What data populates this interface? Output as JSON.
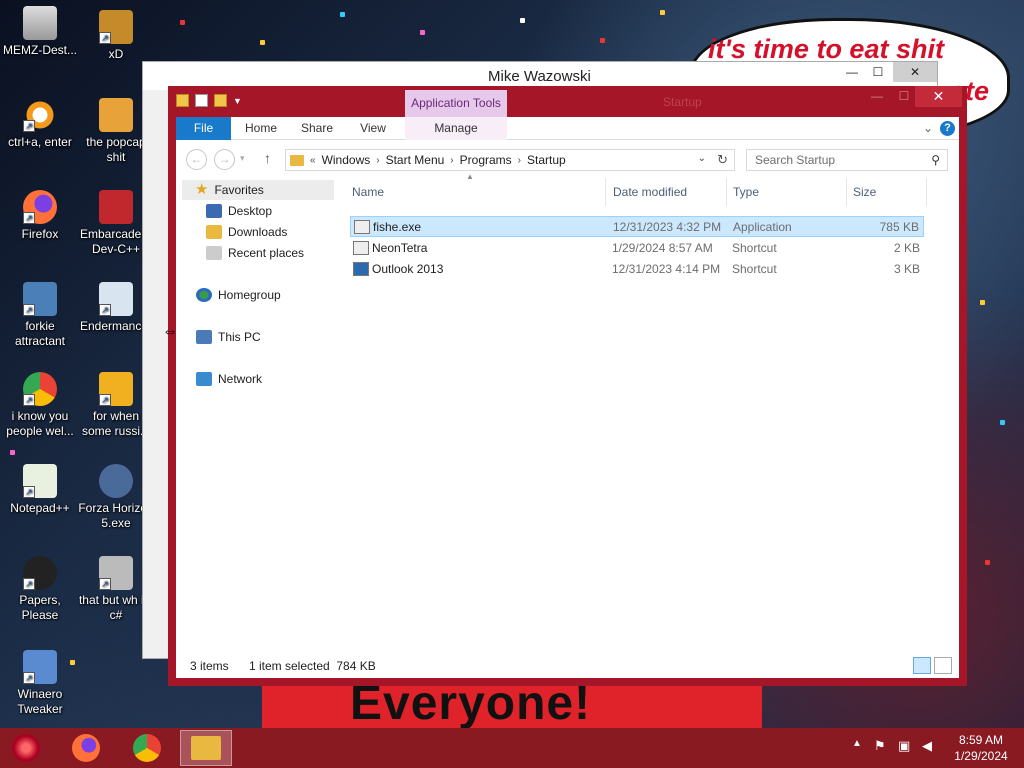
{
  "desktop": {
    "icons": [
      {
        "label": "MEMZ-Dest..."
      },
      {
        "label": "xD"
      },
      {
        "label": "ctrl+a, enter"
      },
      {
        "label": "the popcap shit"
      },
      {
        "label": "Firefox"
      },
      {
        "label": "Embarcadero Dev-C++"
      },
      {
        "label": "forkie attractant"
      },
      {
        "label": "Endermancer"
      },
      {
        "label": "i know you people wel..."
      },
      {
        "label": "for when some russi..."
      },
      {
        "label": "Notepad++"
      },
      {
        "label": "Forza Horizon 5.exe"
      },
      {
        "label": "Papers, Please"
      },
      {
        "label": "that but wh its c#"
      },
      {
        "label": "Winaero Tweaker"
      }
    ],
    "bubble_text_1": "it's time to eat shit",
    "bubble_text_2": "ate",
    "banner_text": "Everyone!"
  },
  "back_window": {
    "title": "Mike Wazowski",
    "minimize": "—",
    "maximize": "☐",
    "close": "✕"
  },
  "window": {
    "title": "Startup",
    "context_tab": "Application Tools",
    "close": "✕",
    "minimize": "—",
    "maximize": "☐"
  },
  "ribbon": {
    "tabs": [
      {
        "label": "File"
      },
      {
        "label": "Home"
      },
      {
        "label": "Share"
      },
      {
        "label": "View"
      },
      {
        "label": "Manage"
      }
    ]
  },
  "address": {
    "prefix": "«",
    "crumbs": [
      "Windows",
      "Start Menu",
      "Programs",
      "Startup"
    ],
    "search_placeholder": "Search Startup"
  },
  "nav": {
    "favorites": "Favorites",
    "desktop": "Desktop",
    "downloads": "Downloads",
    "recent": "Recent places",
    "homegroup": "Homegroup",
    "thispc": "This PC",
    "network": "Network"
  },
  "columns": {
    "name": "Name",
    "date": "Date modified",
    "type": "Type",
    "size": "Size"
  },
  "files": [
    {
      "name": "fishe.exe",
      "date": "12/31/2023 4:32 PM",
      "type": "Application",
      "size": "785 KB"
    },
    {
      "name": "NeonTetra",
      "date": "1/29/2024 8:57 AM",
      "type": "Shortcut",
      "size": "2 KB"
    },
    {
      "name": "Outlook 2013",
      "date": "12/31/2023 4:14 PM",
      "type": "Shortcut",
      "size": "3 KB"
    }
  ],
  "status": {
    "count": "3 items",
    "selected": "1 item selected  784 KB"
  },
  "taskbar": {
    "time": "8:59 AM",
    "date": "1/29/2024"
  }
}
